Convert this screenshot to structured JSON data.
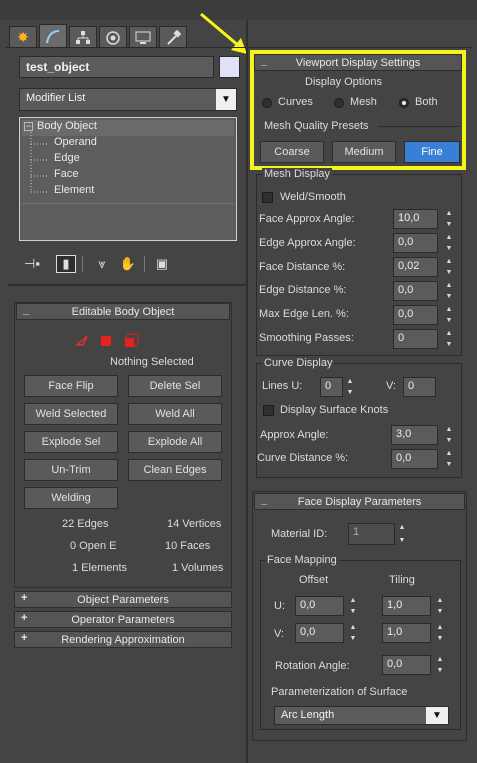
{
  "colors": {
    "accent": "#3a7fd6",
    "highlight": "#f5f51a",
    "background": "#444444"
  },
  "tabs": [
    {
      "icon": "star-burst-icon"
    },
    {
      "icon": "modify-curve-icon"
    },
    {
      "icon": "hierarchy-icon"
    },
    {
      "icon": "motion-icon"
    },
    {
      "icon": "display-monitor-icon"
    },
    {
      "icon": "hammer-utilities-icon"
    }
  ],
  "object": {
    "name": "test_object"
  },
  "modifier": {
    "label": "Modifier List"
  },
  "stack": {
    "items": [
      "Body Object",
      "Operand",
      "Edge",
      "Face",
      "Element"
    ]
  },
  "editable": {
    "title": "Editable Body Object",
    "selection_status": "Nothing Selected",
    "buttons": [
      "Face Flip",
      "Delete Sel",
      "Weld Selected",
      "Weld All",
      "Explode Sel",
      "Explode All",
      "Un-Trim",
      "Clean Edges",
      "Welding"
    ],
    "stats": [
      "22 Edges",
      "14 Vertices",
      "0 Open E",
      "10 Faces",
      "1 Elements",
      "1 Volumes"
    ]
  },
  "collapsed_rollouts": [
    "Object Parameters",
    "Operator Parameters",
    "Rendering Approximation"
  ],
  "viewport": {
    "title": "Viewport Display Settings",
    "display_options": "Display Options",
    "radios": [
      "Curves",
      "Mesh",
      "Both"
    ],
    "selected": "Both",
    "presets_label": "Mesh Quality Presets",
    "presets": [
      "Coarse",
      "Medium",
      "Fine"
    ],
    "active_preset": "Fine"
  },
  "mesh_display": {
    "title": "Mesh Display",
    "weld_smooth": "Weld/Smooth",
    "rows": [
      {
        "label": "Face Approx Angle:",
        "value": "10,0"
      },
      {
        "label": "Edge Approx Angle:",
        "value": "0,0"
      },
      {
        "label": "Face Distance %:",
        "value": "0,02"
      },
      {
        "label": "Edge Distance %:",
        "value": "0,0"
      },
      {
        "label": "Max Edge Len. %:",
        "value": "0,0"
      },
      {
        "label": "Smoothing Passes:",
        "value": "0"
      }
    ]
  },
  "curve_display": {
    "title": "Curve Display",
    "lines_u_label": "Lines U:",
    "lines_u": "0",
    "v_label": "V:",
    "v": "0",
    "surface_knots": "Display Surface Knots",
    "approx_label": "Approx Angle:",
    "approx": "3,0",
    "dist_label": "Curve Distance %:",
    "dist": "0,0"
  },
  "face_display": {
    "title": "Face Display Parameters",
    "material_label": "Material ID:",
    "material": "1",
    "mapping_title": "Face Mapping",
    "offset": "Offset",
    "tiling": "Tiling",
    "u_label": "U:",
    "v_label": "V:",
    "offset_u": "0,0",
    "offset_v": "0,0",
    "tiling_u": "1,0",
    "tiling_v": "1,0",
    "rotation_label": "Rotation Angle:",
    "rotation": "0,0",
    "param_label": "Parameterization of Surface",
    "param_value": "Arc Length"
  }
}
